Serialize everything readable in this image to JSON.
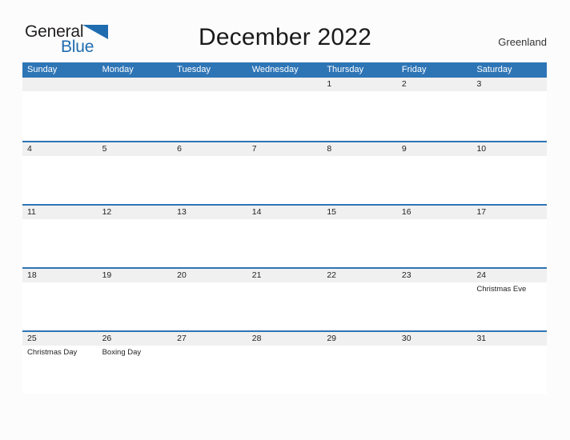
{
  "brand": {
    "name_part1": "General",
    "name_part2": "Blue",
    "flag_icon": "blue-triangle-flag-icon",
    "color_dark": "#231f20",
    "color_blue": "#1f6cb0"
  },
  "header": {
    "title": "December 2022",
    "locale": "Greenland"
  },
  "theme": {
    "header_blue": "#2e75b6",
    "date_band_gray": "#f0f0f0",
    "page_background": "#fcfcfc",
    "text_dark": "#222222"
  },
  "calendar": {
    "month": "December",
    "year": "2022",
    "weekday_headers": [
      "Sunday",
      "Monday",
      "Tuesday",
      "Wednesday",
      "Thursday",
      "Friday",
      "Saturday"
    ],
    "weeks": [
      {
        "days": [
          {
            "date": "",
            "events": []
          },
          {
            "date": "",
            "events": []
          },
          {
            "date": "",
            "events": []
          },
          {
            "date": "",
            "events": []
          },
          {
            "date": "1",
            "events": []
          },
          {
            "date": "2",
            "events": []
          },
          {
            "date": "3",
            "events": []
          }
        ]
      },
      {
        "days": [
          {
            "date": "4",
            "events": []
          },
          {
            "date": "5",
            "events": []
          },
          {
            "date": "6",
            "events": []
          },
          {
            "date": "7",
            "events": []
          },
          {
            "date": "8",
            "events": []
          },
          {
            "date": "9",
            "events": []
          },
          {
            "date": "10",
            "events": []
          }
        ]
      },
      {
        "days": [
          {
            "date": "11",
            "events": []
          },
          {
            "date": "12",
            "events": []
          },
          {
            "date": "13",
            "events": []
          },
          {
            "date": "14",
            "events": []
          },
          {
            "date": "15",
            "events": []
          },
          {
            "date": "16",
            "events": []
          },
          {
            "date": "17",
            "events": []
          }
        ]
      },
      {
        "days": [
          {
            "date": "18",
            "events": []
          },
          {
            "date": "19",
            "events": []
          },
          {
            "date": "20",
            "events": []
          },
          {
            "date": "21",
            "events": []
          },
          {
            "date": "22",
            "events": []
          },
          {
            "date": "23",
            "events": []
          },
          {
            "date": "24",
            "events": [
              "Christmas Eve"
            ]
          }
        ]
      },
      {
        "days": [
          {
            "date": "25",
            "events": [
              "Christmas Day"
            ]
          },
          {
            "date": "26",
            "events": [
              "Boxing Day"
            ]
          },
          {
            "date": "27",
            "events": []
          },
          {
            "date": "28",
            "events": []
          },
          {
            "date": "29",
            "events": []
          },
          {
            "date": "30",
            "events": []
          },
          {
            "date": "31",
            "events": []
          }
        ]
      }
    ]
  }
}
